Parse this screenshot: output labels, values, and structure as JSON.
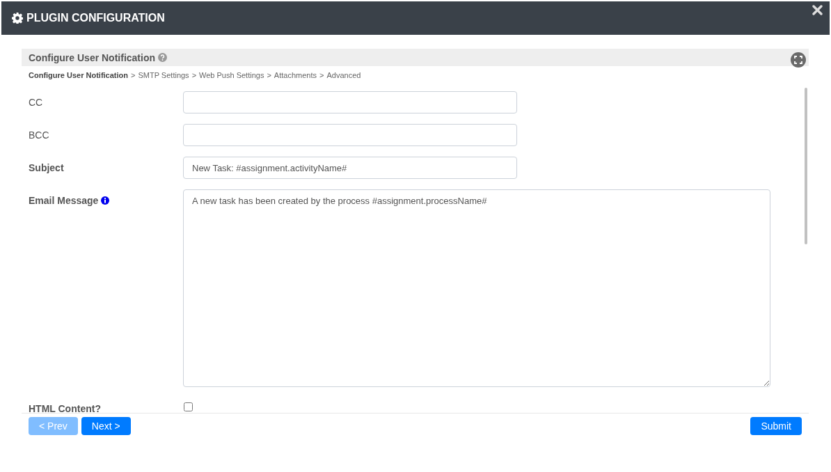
{
  "window": {
    "title": "PLUGIN CONFIGURATION"
  },
  "section": {
    "title": "Configure User Notification"
  },
  "breadcrumb": [
    {
      "label": "Configure User Notification",
      "selected": true
    },
    {
      "label": "SMTP Settings",
      "selected": false
    },
    {
      "label": "Web Push Settings",
      "selected": false
    },
    {
      "label": "Attachments",
      "selected": false
    },
    {
      "label": "Advanced",
      "selected": false
    }
  ],
  "breadcrumb_separator": ">",
  "fields": [
    {
      "kind": "text",
      "label": "CC",
      "emphasized": false,
      "info": false
    },
    {
      "kind": "text",
      "label": "BCC",
      "emphasized": false,
      "info": false
    },
    {
      "kind": "text",
      "label": "Subject",
      "emphasized": true,
      "info": false,
      "value": "New Task: #assignment.activityName#"
    },
    {
      "kind": "textarea",
      "label": "Email Message",
      "emphasized": true,
      "info": true,
      "value": "A new task has been created by the process #assignment.processName#"
    },
    {
      "kind": "checkbox",
      "label": "HTML Content?",
      "emphasized": true,
      "info": false,
      "checked": false
    }
  ],
  "buttons": [
    {
      "kind": "prev",
      "label": "< Prev",
      "disabled": true
    },
    {
      "kind": "next",
      "label": "Next >",
      "disabled": false
    },
    {
      "kind": "submit",
      "label": "Submit",
      "disabled": false
    }
  ]
}
